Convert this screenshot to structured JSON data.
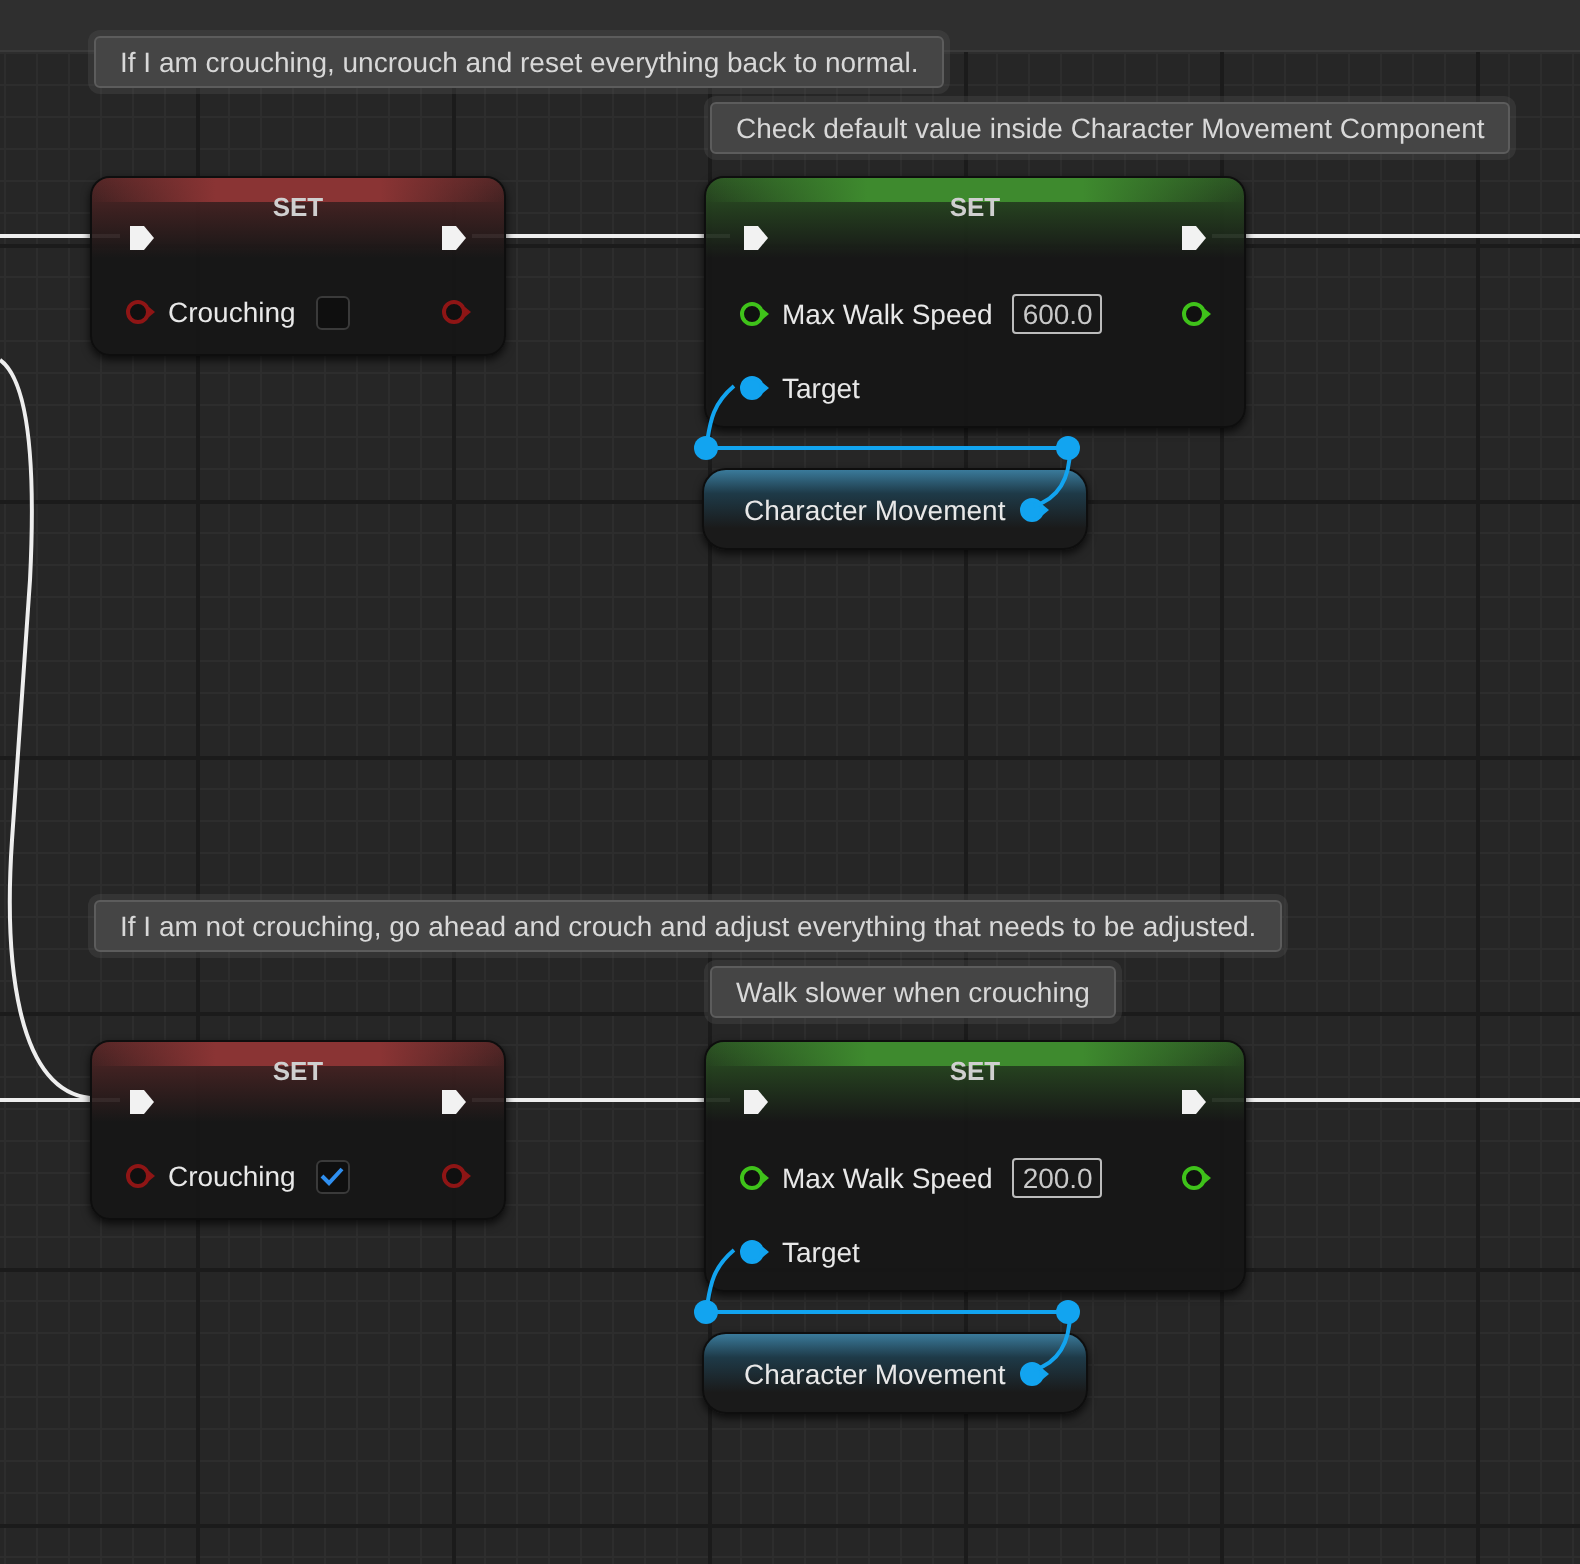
{
  "groups": [
    {
      "comments": [
        {
          "text": "If I am crouching, uncrouch and reset everything back to normal."
        },
        {
          "text": "Check default value inside Character Movement Component"
        }
      ],
      "variable_node": {
        "title": "SET",
        "label": "Crouching",
        "checked": false
      },
      "speed_node": {
        "title": "SET",
        "label": "Max Walk Speed",
        "value": "600.0",
        "target_label": "Target"
      },
      "component_node": {
        "label": "Character Movement"
      }
    },
    {
      "comments": [
        {
          "text": "If I am not crouching, go ahead and crouch and adjust everything that needs to be adjusted."
        },
        {
          "text": "Walk slower when crouching"
        }
      ],
      "variable_node": {
        "title": "SET",
        "label": "Crouching",
        "checked": true
      },
      "speed_node": {
        "title": "SET",
        "label": "Max Walk Speed",
        "value": "200.0",
        "target_label": "Target"
      },
      "component_node": {
        "label": "Character Movement"
      }
    }
  ]
}
